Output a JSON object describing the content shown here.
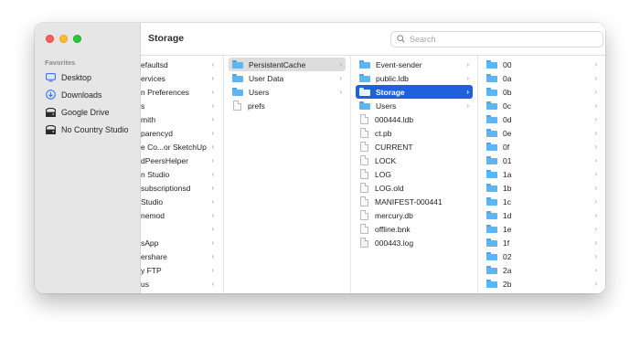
{
  "window": {
    "title": "Storage"
  },
  "search": {
    "placeholder": "Search"
  },
  "sidebar": {
    "section_label": "Favorites",
    "items": [
      {
        "label": "Desktop",
        "icon": "desktop-icon"
      },
      {
        "label": "Downloads",
        "icon": "downloads-icon"
      },
      {
        "label": "Google Drive",
        "icon": "drive-icon"
      },
      {
        "label": "No Country Studio",
        "icon": "drive-icon"
      }
    ]
  },
  "columns": {
    "col1": [
      {
        "label": "efaultsd",
        "chevron": true
      },
      {
        "label": "ervices",
        "chevron": true
      },
      {
        "label": "n Preferences",
        "chevron": true
      },
      {
        "label": "s",
        "chevron": true
      },
      {
        "label": "mith",
        "chevron": true
      },
      {
        "label": "parencyd",
        "chevron": true
      },
      {
        "label": "e Co...or SketchUp",
        "chevron": true
      },
      {
        "label": "dPeersHelper",
        "chevron": true
      },
      {
        "label": "n Studio",
        "chevron": true
      },
      {
        "label": "subscriptionsd",
        "chevron": true
      },
      {
        "label": "Studio",
        "chevron": true
      },
      {
        "label": "nemod",
        "chevron": true
      },
      {
        "label": "",
        "chevron": true
      },
      {
        "label": "sApp",
        "chevron": true
      },
      {
        "label": "ershare",
        "chevron": true
      },
      {
        "label": "y FTP",
        "chevron": true
      },
      {
        "label": "us",
        "chevron": true
      }
    ],
    "col2": [
      {
        "label": "PersistentCache",
        "type": "folder",
        "chevron": true,
        "state": "active"
      },
      {
        "label": "User Data",
        "type": "folder",
        "chevron": true
      },
      {
        "label": "Users",
        "type": "folder",
        "chevron": true
      },
      {
        "label": "prefs",
        "type": "file",
        "chevron": false
      }
    ],
    "col3": [
      {
        "label": "Event-sender",
        "type": "folder",
        "chevron": true
      },
      {
        "label": "public.ldb",
        "type": "folder",
        "chevron": true
      },
      {
        "label": "Storage",
        "type": "folder",
        "chevron": true,
        "state": "selected"
      },
      {
        "label": "Users",
        "type": "folder",
        "chevron": true
      },
      {
        "label": "000444.ldb",
        "type": "file",
        "chevron": false
      },
      {
        "label": "ct.pb",
        "type": "file",
        "chevron": false
      },
      {
        "label": "CURRENT",
        "type": "file",
        "chevron": false
      },
      {
        "label": "LOCK",
        "type": "file",
        "chevron": false
      },
      {
        "label": "LOG",
        "type": "file",
        "chevron": false
      },
      {
        "label": "LOG.old",
        "type": "file",
        "chevron": false
      },
      {
        "label": "MANIFEST-000441",
        "type": "file",
        "chevron": false
      },
      {
        "label": "mercury.db",
        "type": "file",
        "chevron": false
      },
      {
        "label": "offline.bnk",
        "type": "file",
        "chevron": false
      },
      {
        "label": "000443.log",
        "type": "logfile",
        "chevron": false
      }
    ],
    "col4": [
      {
        "label": "00",
        "type": "folder",
        "chevron": true
      },
      {
        "label": "0a",
        "type": "folder",
        "chevron": true
      },
      {
        "label": "0b",
        "type": "folder",
        "chevron": true
      },
      {
        "label": "0c",
        "type": "folder",
        "chevron": true
      },
      {
        "label": "0d",
        "type": "folder",
        "chevron": true
      },
      {
        "label": "0e",
        "type": "folder",
        "chevron": true
      },
      {
        "label": "0f",
        "type": "folder",
        "chevron": true
      },
      {
        "label": "01",
        "type": "folder",
        "chevron": true
      },
      {
        "label": "1a",
        "type": "folder",
        "chevron": true
      },
      {
        "label": "1b",
        "type": "folder",
        "chevron": true
      },
      {
        "label": "1c",
        "type": "folder",
        "chevron": true
      },
      {
        "label": "1d",
        "type": "folder",
        "chevron": true
      },
      {
        "label": "1e",
        "type": "folder",
        "chevron": true
      },
      {
        "label": "1f",
        "type": "folder",
        "chevron": true
      },
      {
        "label": "02",
        "type": "folder",
        "chevron": true
      },
      {
        "label": "2a",
        "type": "folder",
        "chevron": true
      },
      {
        "label": "2b",
        "type": "folder",
        "chevron": true
      }
    ]
  },
  "colors": {
    "selection": "#1d62dc",
    "active_row": "#dddddd",
    "folder": "#5db6f2",
    "sidebar_bg": "#e7e6e6",
    "sidebar_icon": "#3478f6"
  }
}
